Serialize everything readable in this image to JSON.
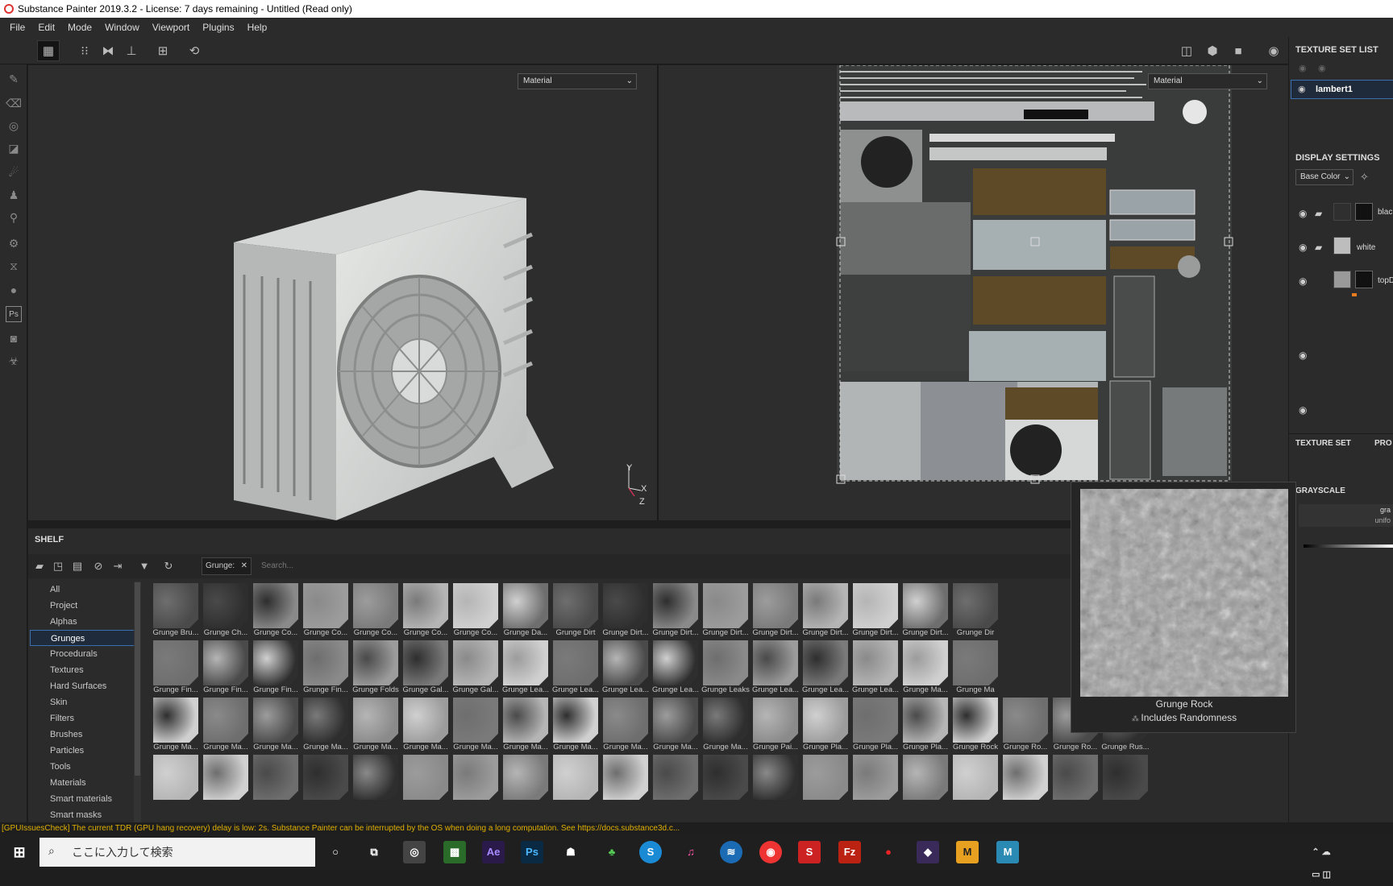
{
  "window": {
    "title": "Substance Painter 2019.3.2 - License: 7 days remaining - Untitled (Read only)"
  },
  "menu": [
    "File",
    "Edit",
    "Mode",
    "Window",
    "Viewport",
    "Plugins",
    "Help"
  ],
  "viewport": {
    "left_mode": "Material",
    "right_mode": "Material",
    "axis": {
      "y": "Y",
      "x": "X",
      "z": "Z"
    }
  },
  "shelf": {
    "title": "SHELF",
    "filter_chip": "Grunge:",
    "search_placeholder": "Search...",
    "categories": [
      "All",
      "Project",
      "Alphas",
      "Grunges",
      "Procedurals",
      "Textures",
      "Hard Surfaces",
      "Skin",
      "Filters",
      "Brushes",
      "Particles",
      "Tools",
      "Materials",
      "Smart materials",
      "Smart masks"
    ],
    "selected_category": "Grunges",
    "rows": [
      [
        "Grunge Bru...",
        "Grunge Ch...",
        "Grunge Co...",
        "Grunge Co...",
        "Grunge Co...",
        "Grunge Co...",
        "Grunge Co...",
        "Grunge Da...",
        "Grunge Dirt",
        "Grunge Dirt...",
        "Grunge Dirt...",
        "Grunge Dirt...",
        "Grunge Dirt...",
        "Grunge Dirt...",
        "Grunge Dirt...",
        "Grunge Dirt...",
        "Grunge Dir"
      ],
      [
        "Grunge Fin...",
        "Grunge Fin...",
        "Grunge Fin...",
        "Grunge Fin...",
        "Grunge Folds",
        "Grunge Gal...",
        "Grunge Gal...",
        "Grunge Lea...",
        "Grunge Lea...",
        "Grunge Lea...",
        "Grunge Lea...",
        "Grunge Leaks",
        "Grunge Lea...",
        "Grunge Lea...",
        "Grunge Lea...",
        "Grunge Ma...",
        "Grunge Ma"
      ],
      [
        "Grunge Ma...",
        "Grunge Ma...",
        "Grunge Ma...",
        "Grunge Ma...",
        "Grunge Ma...",
        "Grunge Ma...",
        "Grunge Ma...",
        "Grunge Ma...",
        "Grunge Ma...",
        "Grunge Ma...",
        "Grunge Ma...",
        "Grunge Ma...",
        "Grunge Pai...",
        "Grunge Pla...",
        "Grunge Pla...",
        "Grunge Pla...",
        "Grunge Rock",
        "Grunge Ro...",
        "Grunge Ro...",
        "Grunge Rus..."
      ],
      [
        "",
        "",
        "",
        "",
        "",
        "",
        "",
        "",
        "",
        "",
        "",
        "",
        "",
        "",
        "",
        "",
        "",
        "",
        "",
        ""
      ]
    ]
  },
  "tooltip": {
    "title": "Grunge Rock",
    "subtitle": "Includes Randomness"
  },
  "right_panel": {
    "texture_set_list": "TEXTURE SET LIST",
    "texture_set": "lambert1",
    "display_settings": "DISPLAY SETTINGS",
    "channel": "Base Color",
    "layers": [
      "black",
      "white",
      "topD"
    ],
    "texture_set_tab": "TEXTURE SET",
    "pro_tab": "PRO",
    "grayscale": "GRAYSCALE",
    "gray_label": "gra",
    "uniform_label": "unifo"
  },
  "log": "[GPUIssuesCheck] The current TDR (GPU hang recovery) delay is low: 2s. Substance Painter can be interrupted by the OS when doing a long computation. See https://docs.substance3d.c...",
  "taskbar": {
    "search_placeholder": "ここに入力して検索"
  }
}
